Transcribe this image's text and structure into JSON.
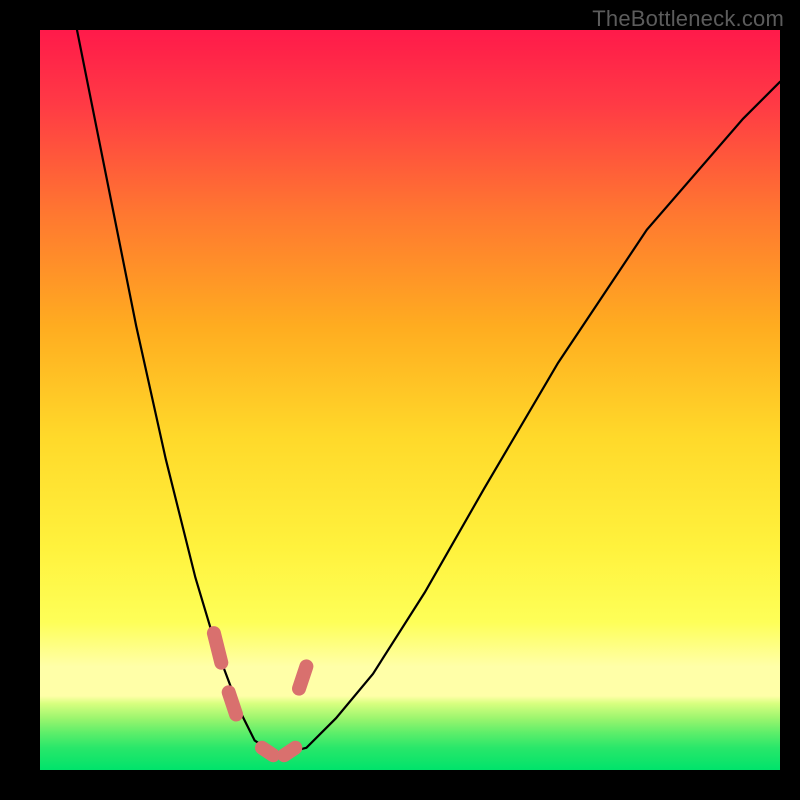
{
  "watermark": "TheBottleneck.com",
  "chart_data": {
    "type": "line",
    "title": "",
    "xlabel": "",
    "ylabel": "",
    "xlim": [
      0,
      100
    ],
    "ylim": [
      0,
      100
    ],
    "grid": false,
    "legend": false,
    "gradient_colors": {
      "top": "#ff1a4a",
      "mid_upper": "#ff9a1f",
      "mid": "#ffe63d",
      "mid_lower": "#f7ff66",
      "band": "#ffffa8",
      "bottom": "#00e36b"
    },
    "series": [
      {
        "name": "bottleneck-curve",
        "color": "#000000",
        "x": [
          5,
          7,
          9,
          11,
          13,
          15,
          17,
          19,
          21,
          24,
          27,
          29,
          32,
          36,
          40,
          45,
          52,
          60,
          70,
          82,
          95,
          100
        ],
        "values": [
          100,
          90,
          80,
          70,
          60,
          51,
          42,
          34,
          26,
          16,
          8,
          4,
          2,
          3,
          7,
          13,
          24,
          38,
          55,
          73,
          88,
          93
        ]
      }
    ],
    "highlight_segments": [
      {
        "name": "left-riser-start",
        "x": [
          23.5,
          24.5
        ],
        "y": [
          18.5,
          14.5
        ]
      },
      {
        "name": "trough-left",
        "x": [
          25.5,
          26.5
        ],
        "y": [
          10.5,
          7.5
        ]
      },
      {
        "name": "trough-right",
        "x": [
          30.0,
          31.5
        ],
        "y": [
          3.0,
          2.0
        ]
      },
      {
        "name": "right-riser-start",
        "x": [
          33.0,
          34.5
        ],
        "y": [
          2.0,
          3.0
        ]
      },
      {
        "name": "right-riser",
        "x": [
          35.0,
          36.0
        ],
        "y": [
          11.0,
          14.0
        ]
      }
    ],
    "highlight_color": "#d9706e"
  }
}
